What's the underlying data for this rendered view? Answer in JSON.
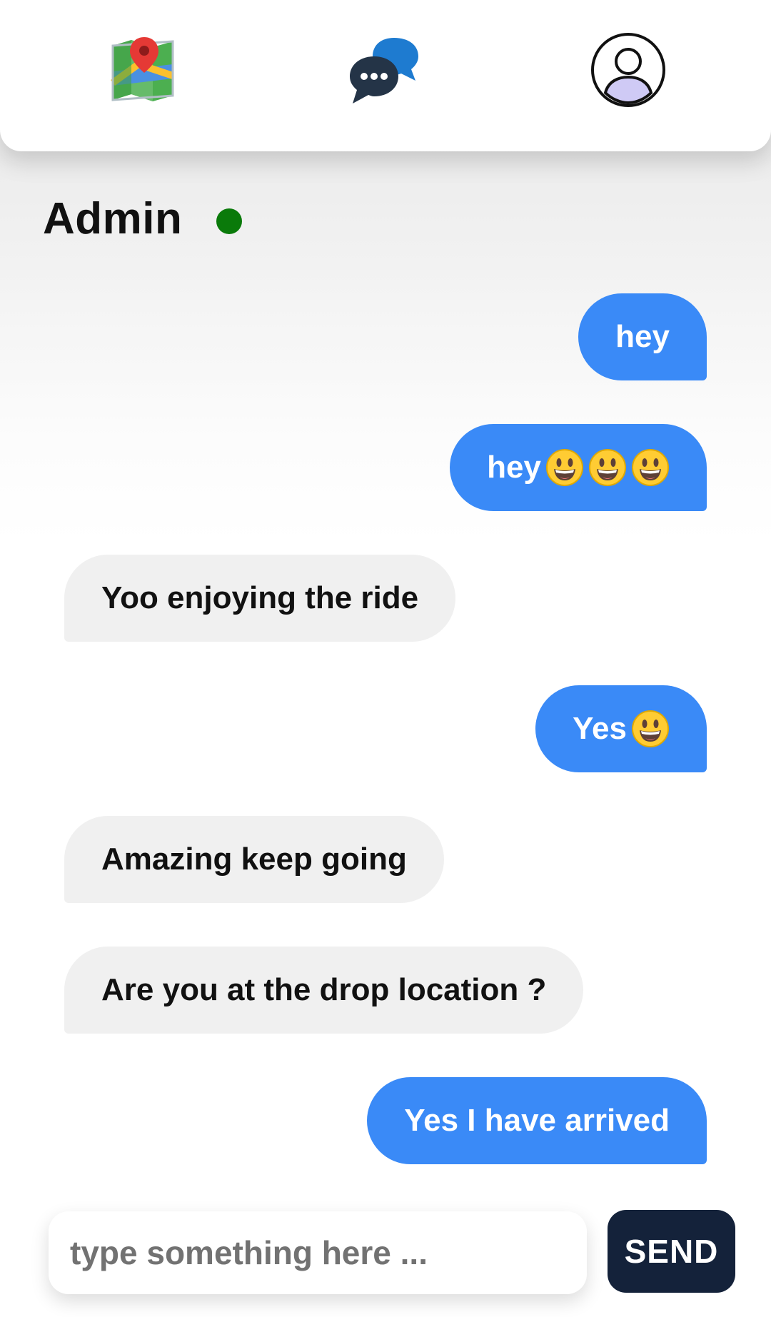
{
  "nav": {
    "items": [
      {
        "id": "map",
        "icon": "map-icon"
      },
      {
        "id": "chat",
        "icon": "chat-bubbles-icon"
      },
      {
        "id": "profile",
        "icon": "profile-icon"
      }
    ]
  },
  "chat": {
    "title": "Admin",
    "status": "online",
    "status_color": "#0a7a0a",
    "messages": [
      {
        "side": "sent",
        "text": "hey",
        "emoji_count": 0
      },
      {
        "side": "sent",
        "text": "hey",
        "emoji_count": 3
      },
      {
        "side": "received",
        "text": "Yoo enjoying the ride",
        "emoji_count": 0
      },
      {
        "side": "sent",
        "text": "Yes",
        "emoji_count": 1
      },
      {
        "side": "received",
        "text": "Amazing keep going",
        "emoji_count": 0
      },
      {
        "side": "received",
        "text": "Are you at the drop location ?",
        "emoji_count": 0
      },
      {
        "side": "sent",
        "text": "Yes I have arrived",
        "emoji_count": 0
      }
    ],
    "emoji": "grinning-face-emoji"
  },
  "composer": {
    "placeholder": "type something here ...",
    "value": "",
    "send_label": "SEND"
  },
  "colors": {
    "sent_bubble": "#3a8af7",
    "received_bubble": "#f0f0f0",
    "send_button": "#14223a"
  }
}
